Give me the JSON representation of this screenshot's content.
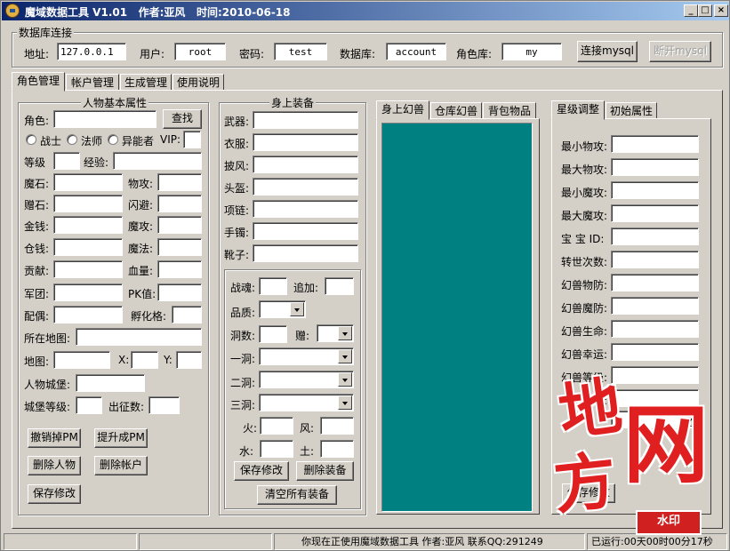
{
  "titlebar": {
    "title": "魔域数据工具 V1.01   作者:亚风   时间:2010-06-18",
    "min": "_",
    "max": "□",
    "close": "×"
  },
  "db": {
    "group_label": "数据库连接",
    "addr_label": "地址:",
    "addr_value": "127.0.0.1",
    "user_label": "用户:",
    "user_value": "root",
    "pass_label": "密码:",
    "pass_value": "test",
    "db_label": "数据库:",
    "db_value": "account",
    "rolelib_label": "角色库:",
    "rolelib_value": "my",
    "connect_btn": "连接mysql",
    "disconnect_btn": "断开mysql"
  },
  "main_tabs": [
    "角色管理",
    "帐户管理",
    "生成管理",
    "使用说明"
  ],
  "basic": {
    "group_label": "人物基本属性",
    "role_label": "角色:",
    "find_btn": "查找",
    "radio_warrior": "战士",
    "radio_mage": "法师",
    "radio_other": "异能者",
    "vip_label": "VIP:",
    "level_label": "等级",
    "exp_label": "经验:",
    "mostone_label": "魔石:",
    "pattack_label": "物攻:",
    "zstone_label": "赠石:",
    "dodge_label": "闪避:",
    "gold_label": "金钱:",
    "mattack_label": "魔攻:",
    "storage_label": "仓钱:",
    "magic_label": "魔法:",
    "contrib_label": "贡献:",
    "hp_label": "血量:",
    "legion_label": "军团:",
    "pk_label": "PK值:",
    "spouse_label": "配偶:",
    "hatch_label": "孵化格:",
    "map_label": "所在地图:",
    "mapid_label": "地图:",
    "x_label": "X:",
    "y_label": "Y:",
    "castle_label": "人物城堡:",
    "castle_level_label": "城堡等级:",
    "expedition_label": "出征数:",
    "cancel_pm_btn": "撤销掉PM",
    "promote_pm_btn": "提升成PM",
    "del_role_btn": "删除人物",
    "del_account_btn": "删除帐户",
    "save_btn": "保存修改"
  },
  "equip": {
    "group_label": "身上装备",
    "slots": [
      "武器:",
      "衣服:",
      "披风:",
      "头盔:",
      "项链:",
      "手镯:",
      "靴子:"
    ],
    "soul_label": "战魂:",
    "add_label": "追加:",
    "quality_label": "品质:",
    "holes_label": "洞数:",
    "gift_label": "赠:",
    "hole1_label": "一洞:",
    "hole2_label": "二洞:",
    "hole3_label": "三洞:",
    "fire_label": "火:",
    "wind_label": "风:",
    "water_label": "水:",
    "earth_label": "土:",
    "save_btn": "保存修改",
    "del_equip_btn": "删除装备",
    "clear_btn": "清空所有装备"
  },
  "pet_tabs": [
    "身上幻兽",
    "仓库幻兽",
    "背包物品"
  ],
  "attr_tabs": [
    "星级调整",
    "初始属性"
  ],
  "star": {
    "labels": [
      "最小物攻:",
      "最大物攻:",
      "最小魔攻:",
      "最大魔攻:",
      "宝 宝 ID:",
      "转世次数:",
      "幻兽物防:",
      "幻兽魔防:",
      "幻兽生命:",
      "幻兽幸运:",
      "幻兽等级:",
      "幻兽身份:"
    ],
    "save_btn": "保存修改"
  },
  "status": {
    "message": "你现在正使用魔域数据工具 作者:亚风 联系QQ:291249",
    "runtime": "已运行:00天00时00分17秒"
  },
  "watermark": {
    "c1": "地",
    "c2": "方",
    "c3": "网",
    "badge": "水印"
  },
  "colors": {
    "titlebar_start": "#0a246a",
    "pet_list_bg": "#008080",
    "watermark": "#e02020"
  }
}
